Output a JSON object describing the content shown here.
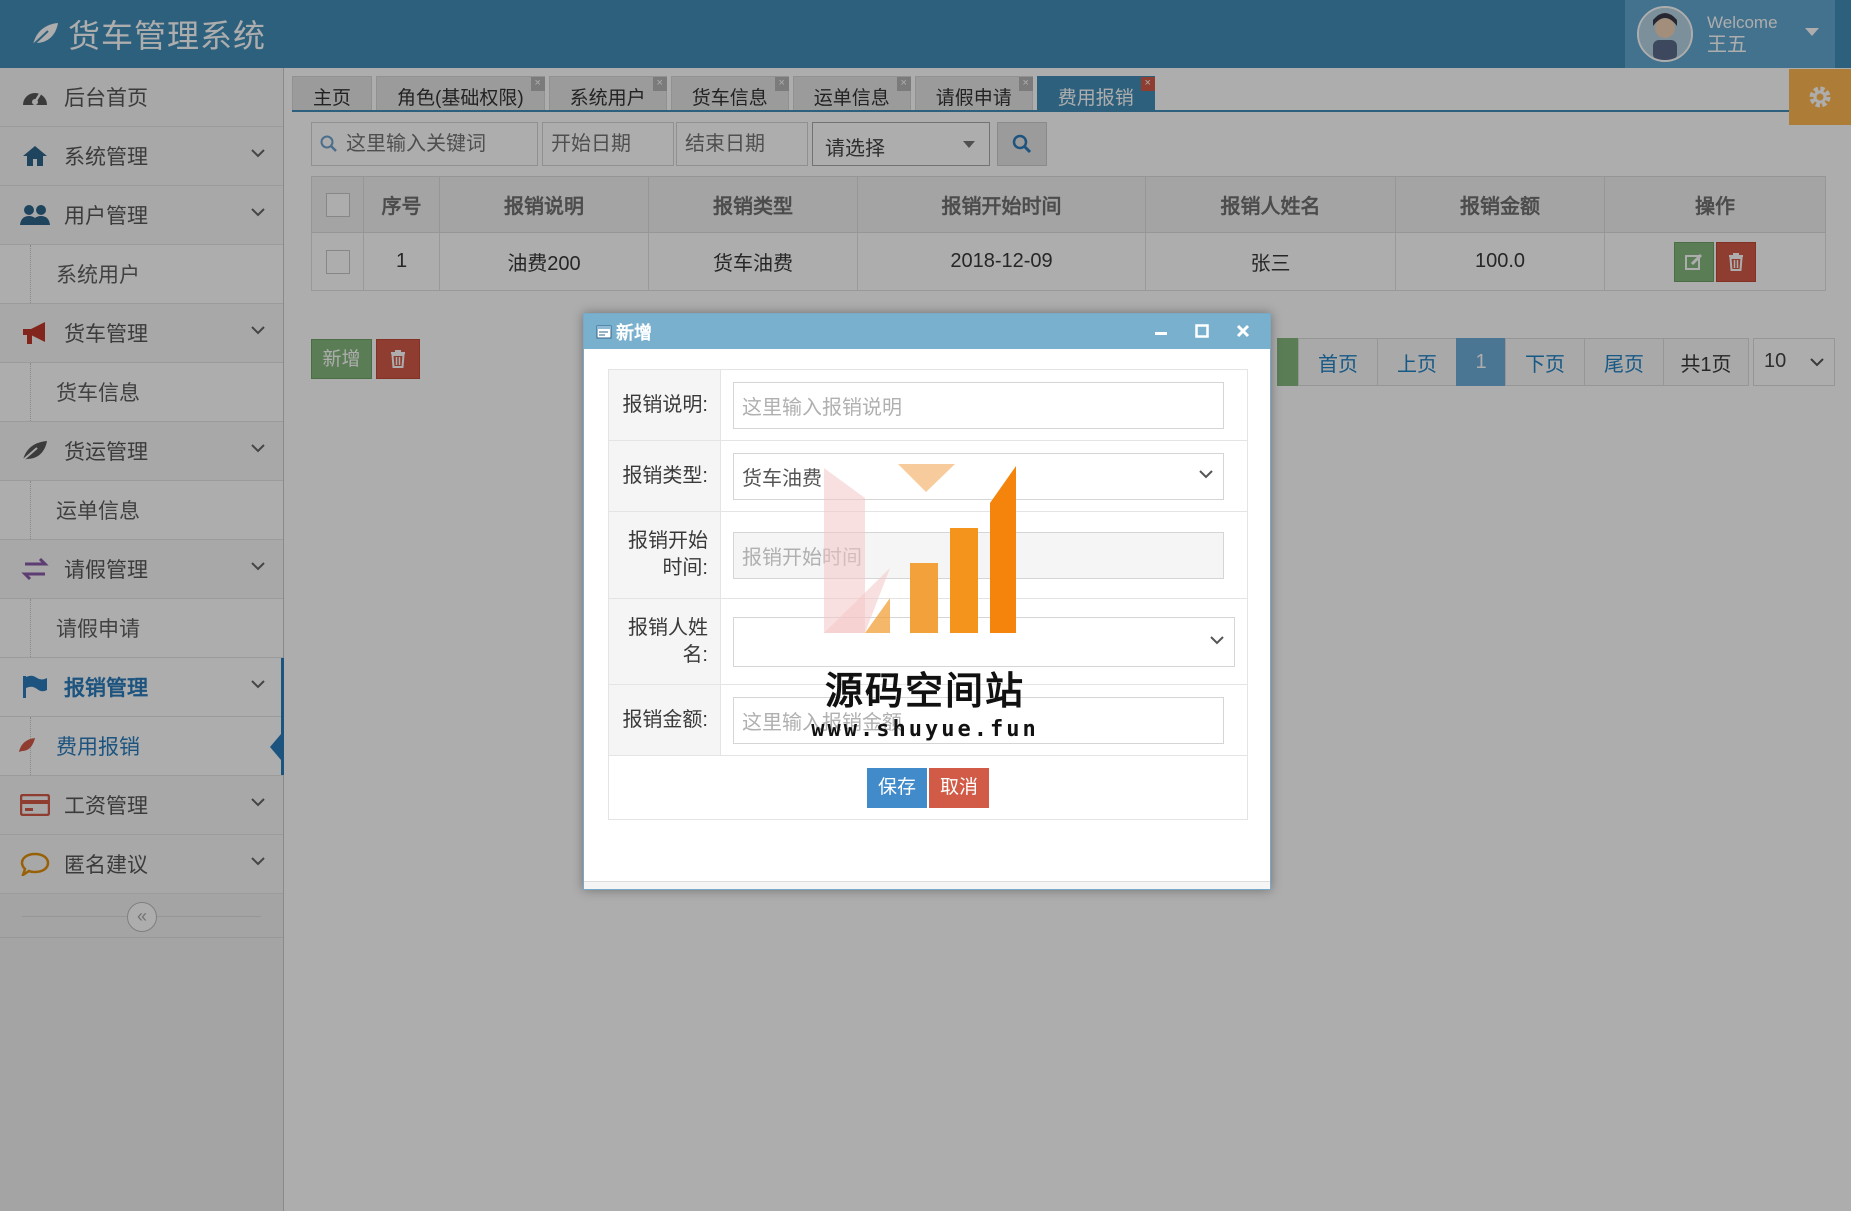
{
  "header": {
    "title": "货车管理系统",
    "welcome": "Welcome",
    "user_name": "王五"
  },
  "sidebar": {
    "items": [
      {
        "label": "后台首页"
      },
      {
        "label": "系统管理"
      },
      {
        "label": "用户管理"
      },
      {
        "label": "系统用户"
      },
      {
        "label": "货车管理"
      },
      {
        "label": "货车信息"
      },
      {
        "label": "货运管理"
      },
      {
        "label": "运单信息"
      },
      {
        "label": "请假管理"
      },
      {
        "label": "请假申请"
      },
      {
        "label": "报销管理"
      },
      {
        "label": "费用报销"
      },
      {
        "label": "工资管理"
      },
      {
        "label": "匿名建议"
      }
    ],
    "collapse": "«"
  },
  "tabs": [
    {
      "label": "主页"
    },
    {
      "label": "角色(基础权限)"
    },
    {
      "label": "系统用户"
    },
    {
      "label": "货车信息"
    },
    {
      "label": "运单信息"
    },
    {
      "label": "请假申请"
    },
    {
      "label": "费用报销"
    }
  ],
  "toolbar": {
    "search_placeholder": "这里输入关键词",
    "start_date_placeholder": "开始日期",
    "end_date_placeholder": "结束日期",
    "select_value": "请选择"
  },
  "table": {
    "headers": [
      "序号",
      "报销说明",
      "报销类型",
      "报销开始时间",
      "报销人姓名",
      "报销金额",
      "操作"
    ],
    "rows": [
      {
        "index": "1",
        "desc": "油费200",
        "type": "货车油费",
        "start": "2018-12-09",
        "name": "张三",
        "amount": "100.0"
      }
    ]
  },
  "actions": {
    "add": "新增"
  },
  "pager": {
    "first": "首页",
    "prev": "上页",
    "current": "1",
    "next": "下页",
    "last": "尾页",
    "total": "共1页",
    "page_size": "10"
  },
  "dialog": {
    "title": "新增",
    "fields": {
      "desc_label": "报销说明:",
      "desc_placeholder": "这里输入报销说明",
      "type_label": "报销类型:",
      "type_value": "货车油费",
      "start_label_1": "报销开始",
      "start_label_2": "时间:",
      "start_placeholder": "报销开始时间",
      "name_label_1": "报销人姓",
      "name_label_2": "名:",
      "amount_label": "报销金额:",
      "amount_placeholder": "这里输入报销金额"
    },
    "save": "保存",
    "cancel": "取消"
  },
  "watermark": {
    "text": "源码空间站",
    "url": "www.shuyue.fun"
  },
  "colors": {
    "header": "#438eb9",
    "accent": "#2b7dbc",
    "success": "#87b87f",
    "danger": "#d15b47",
    "settings": "#ffb752"
  }
}
